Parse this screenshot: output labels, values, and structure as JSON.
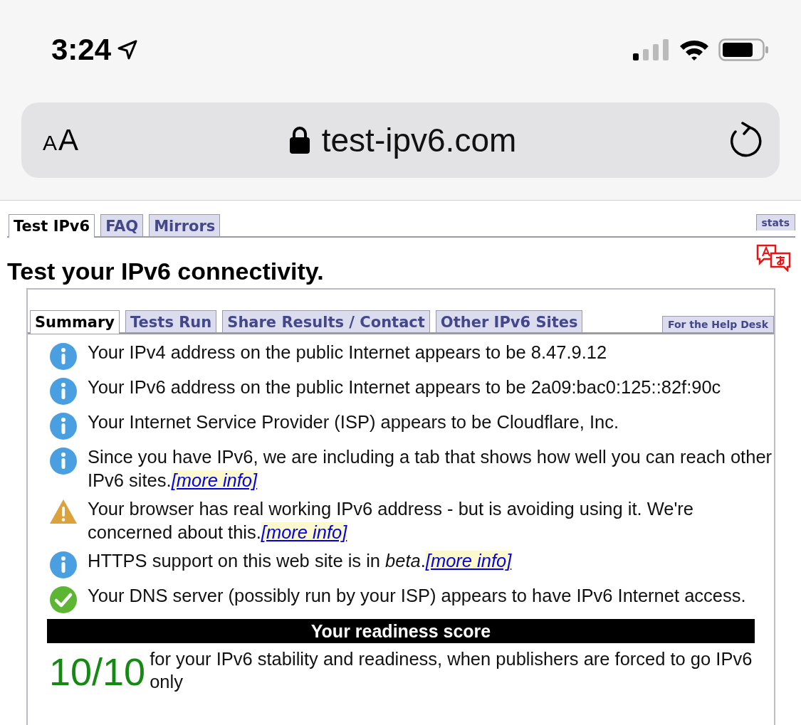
{
  "status_bar": {
    "time": "3:24"
  },
  "address_bar": {
    "text_size_label": "AA",
    "url": "test-ipv6.com"
  },
  "site_tabs": [
    {
      "label": "Test IPv6",
      "selected": true
    },
    {
      "label": "FAQ",
      "selected": false
    },
    {
      "label": "Mirrors",
      "selected": false
    }
  ],
  "stats_tab": "stats",
  "title": "Test your IPv6 connectivity.",
  "result_tabs": [
    {
      "label": "Summary",
      "selected": true
    },
    {
      "label": "Tests Run",
      "selected": false
    },
    {
      "label": "Share Results / Contact",
      "selected": false
    },
    {
      "label": "Other IPv6 Sites",
      "selected": false
    }
  ],
  "help_desk_tab": "For the Help Desk",
  "messages": [
    {
      "kind": "info",
      "text": "Your IPv4 address on the public Internet appears to be 8.47.9.12"
    },
    {
      "kind": "info",
      "text": "Your IPv6 address on the public Internet appears to be 2a09:bac0:125::82f:90c"
    },
    {
      "kind": "info",
      "text": "Your Internet Service Provider (ISP) appears to be Cloudflare, Inc."
    },
    {
      "kind": "info",
      "text": "Since you have IPv6, we are including a tab that shows how well you can reach other IPv6 sites.",
      "link": "[more info]"
    },
    {
      "kind": "warning",
      "text": "Your browser has real working IPv6 address - but is avoiding using it. We're concerned about this.",
      "link": "[more info]"
    },
    {
      "kind": "info",
      "text": "HTTPS support on this web site is in *beta*.",
      "link": "[more info]"
    },
    {
      "kind": "ok",
      "text": "Your DNS server (possibly run by your ISP) appears to have IPv6 Internet access."
    }
  ],
  "score": {
    "heading": "Your readiness score",
    "value": "10/10",
    "description": "for your IPv6 stability and readiness, when publishers are forced to go IPv6 only"
  }
}
